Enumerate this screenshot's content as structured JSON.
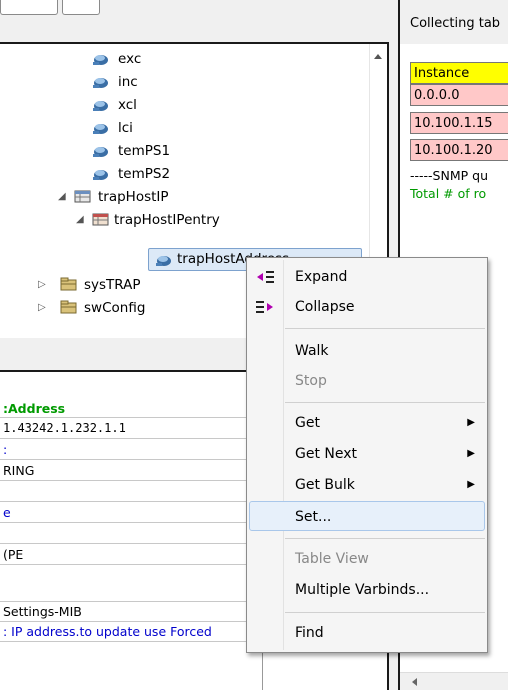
{
  "tree": {
    "nodes": [
      {
        "label": "exc",
        "icon": "leaf-node-icon"
      },
      {
        "label": "inc",
        "icon": "leaf-node-icon"
      },
      {
        "label": "xcl",
        "icon": "leaf-node-icon"
      },
      {
        "label": "lci",
        "icon": "leaf-node-icon"
      },
      {
        "label": "temPS1",
        "icon": "leaf-node-icon"
      },
      {
        "label": "temPS2",
        "icon": "leaf-node-icon"
      },
      {
        "label": "trapHostIP",
        "icon": "table-icon"
      },
      {
        "label": "trapHostIPentry",
        "icon": "table-entry-icon"
      },
      {
        "label": "trapHostAddress",
        "icon": "column-node-icon"
      },
      {
        "label": "sysTRAP",
        "icon": "folder-icon"
      },
      {
        "label": "swConfig",
        "icon": "folder-icon"
      }
    ]
  },
  "details": {
    "rows": [
      ":Address",
      "1.43242.1.232.1.1",
      ":",
      "RING",
      "",
      "e",
      "",
      "(PE",
      "",
      "Settings-MIB",
      ": IP address.to update use Forced"
    ]
  },
  "right_panel": {
    "status": "Collecting tab",
    "table": {
      "header": "Instance",
      "rows": [
        "0.0.0.0",
        "10.100.1.15",
        "10.100.1.20"
      ]
    },
    "query_text": "-----SNMP qu",
    "total_text": "Total # of ro"
  },
  "context_menu": {
    "items": [
      {
        "label": "Expand",
        "icon": "expand-icon",
        "enabled": true
      },
      {
        "label": "Collapse",
        "icon": "collapse-icon",
        "enabled": true
      },
      {
        "label": "Walk",
        "enabled": true
      },
      {
        "label": "Stop",
        "enabled": false
      },
      {
        "label": "Get",
        "submenu": true,
        "enabled": true
      },
      {
        "label": "Get Next",
        "submenu": true,
        "enabled": true
      },
      {
        "label": "Get Bulk",
        "submenu": true,
        "enabled": true
      },
      {
        "label": "Set...",
        "enabled": true,
        "highlighted": true
      },
      {
        "label": "Table View",
        "enabled": false
      },
      {
        "label": "Multiple Varbinds...",
        "enabled": true
      },
      {
        "label": "Find",
        "enabled": true
      }
    ]
  },
  "colors": {
    "table_header": "#ffff00",
    "table_row": "#ffc8c8",
    "details_header": "#009a00",
    "details_link": "#0000cc",
    "query_text": "#000000",
    "total_text": "#009a00"
  }
}
